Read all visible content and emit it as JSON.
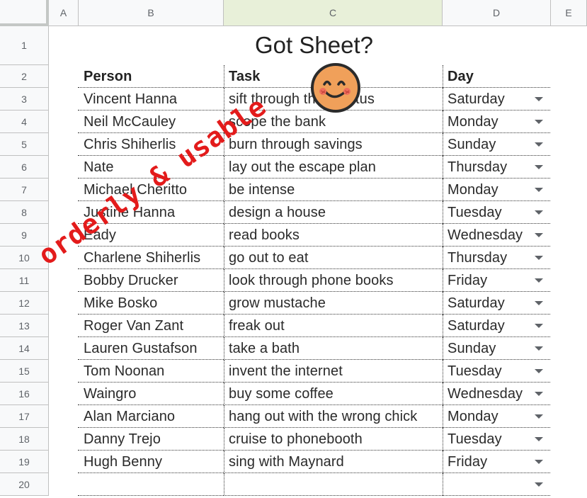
{
  "columns": [
    "A",
    "B",
    "C",
    "D",
    "E"
  ],
  "rows": [
    "1",
    "2",
    "3",
    "4",
    "5",
    "6",
    "7",
    "8",
    "9",
    "10",
    "11",
    "12",
    "13",
    "14",
    "15",
    "16",
    "17",
    "18",
    "19",
    "20"
  ],
  "title": "Got Sheet?",
  "headers": {
    "person": "Person",
    "task": "Task",
    "day": "Day"
  },
  "entries": [
    {
      "person": "Vincent Hanna",
      "task": "sift through the detritus",
      "day": "Saturday"
    },
    {
      "person": "Neil McCauley",
      "task": "scope the bank",
      "day": "Monday"
    },
    {
      "person": "Chris Shiherlis",
      "task": "burn through savings",
      "day": "Sunday"
    },
    {
      "person": "Nate",
      "task": "lay out the escape plan",
      "day": "Thursday"
    },
    {
      "person": "Michael Cheritto",
      "task": "be intense",
      "day": "Monday"
    },
    {
      "person": "Justine Hanna",
      "task": "design a house",
      "day": "Tuesday"
    },
    {
      "person": "Eady",
      "task": "read books",
      "day": "Wednesday"
    },
    {
      "person": "Charlene Shiherlis",
      "task": "go out to eat",
      "day": "Thursday"
    },
    {
      "person": "Bobby Drucker",
      "task": "look through phone books",
      "day": "Friday"
    },
    {
      "person": "Mike Bosko",
      "task": "grow mustache",
      "day": "Saturday"
    },
    {
      "person": "Roger Van Zant",
      "task": "freak out",
      "day": "Saturday"
    },
    {
      "person": "Lauren Gustafson",
      "task": "take a bath",
      "day": "Sunday"
    },
    {
      "person": "Tom Noonan",
      "task": "invent the internet",
      "day": "Tuesday"
    },
    {
      "person": "Waingro",
      "task": "buy some coffee",
      "day": "Wednesday"
    },
    {
      "person": "Alan Marciano",
      "task": "hang out with the wrong chick",
      "day": "Monday"
    },
    {
      "person": "Danny Trejo",
      "task": "cruise to phonebooth",
      "day": "Tuesday"
    },
    {
      "person": "Hugh Benny",
      "task": "sing with Maynard",
      "day": "Friday"
    },
    {
      "person": "",
      "task": "",
      "day": ""
    }
  ],
  "overlay_text": "orderly & usable",
  "colors": {
    "stamp": "#e31b1b",
    "smiley": "#f0a05a",
    "selected_column": "#e8f0d9"
  }
}
